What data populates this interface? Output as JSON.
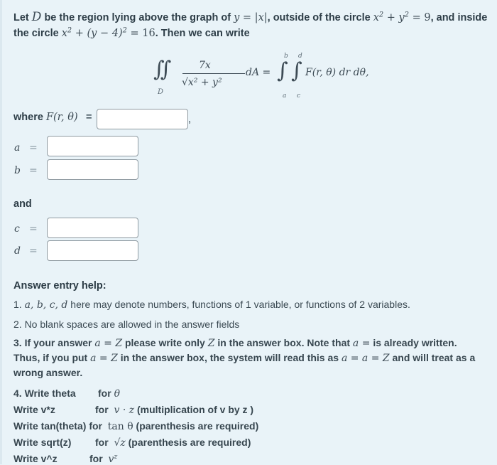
{
  "problem": {
    "intro_line1": {
      "t1": "Let ",
      "D": "D",
      "t2": " be the region lying above the graph of ",
      "eq1": "y = |x|",
      "t3": ", outside of the circle ",
      "eq2a": "x",
      "eq2b": " + y",
      "eq2c": " = 9",
      "t4": ", and inside"
    },
    "intro_line2": {
      "t1": "the circle ",
      "eq_a": "x",
      "eq_b": " + (y − 4)",
      "eq_c": " = 16",
      "t2": ". Then we can write"
    },
    "sup2": "2"
  },
  "formula": {
    "lhs_integral": "∫∫",
    "lhs_region": "D",
    "numerator": "7x",
    "denominator": "√x² + y²",
    "dA": "dA =",
    "rhs_outer_upper": "b",
    "rhs_outer_lower": "a",
    "rhs_inner_upper": "d",
    "rhs_inner_lower": "c",
    "integrand": "F(r, θ) dr dθ,"
  },
  "answers": {
    "where_label": "where ",
    "F_label": "F(r, θ)",
    "equals_plain": "=",
    "comma": ",",
    "F_value": "",
    "a_label": "a",
    "a_value": "",
    "b_label": "b",
    "b_value": "",
    "and_label": "and",
    "c_label": "c",
    "c_value": "",
    "d_label": "d",
    "d_value": "",
    "equals_math": "="
  },
  "help": {
    "title": "Answer entry help:",
    "item1_prefix": "1. ",
    "item1_vars": "a, b, c, d",
    "item1_text": " here may denote numbers, functions of 1 variable, or functions of 2 variables.",
    "item2": "2. No blank spaces are allowed in the answer fields",
    "item3_line1": {
      "t1": "3. If your answer ",
      "m1": "a = Z",
      "t2": " please write only ",
      "m2": "Z",
      "t3": " in the answer box. Note that ",
      "m3": "a =",
      "t4": " is already written."
    },
    "item3_line2": {
      "t1": "Thus, if you put ",
      "m1": "a = Z",
      "t2": " in the answer box, the system will read this as ",
      "m2": "a = a = Z",
      "t3": " and will treat as a"
    },
    "item3_line3": "wrong answer.",
    "rules": [
      {
        "write": "4. Write theta",
        "for": "for",
        "math": "θ",
        "note": ""
      },
      {
        "write": "Write v*z",
        "for": "for",
        "math": "v · z",
        "note": " (multiplication of v by z )"
      },
      {
        "write": "Write tan(theta)",
        "for": "for",
        "math": "tan θ",
        "note": "  (parenthesis are required)"
      },
      {
        "write": "Write sqrt(z)",
        "for": "for",
        "math": "√z",
        "note": "  (parenthesis are required)"
      },
      {
        "write": "Write v^z",
        "for": "for",
        "math": "v",
        "math_sup": "z",
        "note": ""
      }
    ]
  }
}
